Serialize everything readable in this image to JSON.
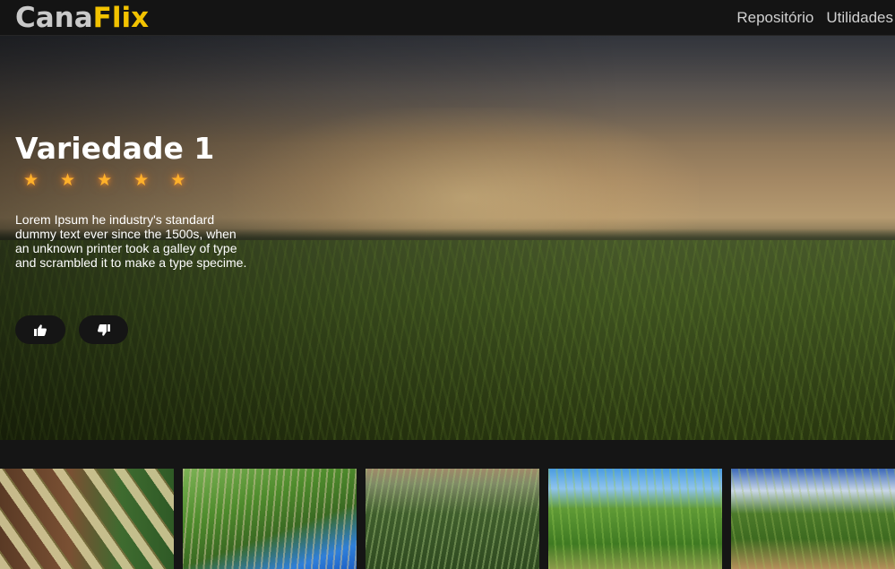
{
  "navbar": {
    "logo_part1": "Cana",
    "logo_part2": "Flix",
    "links": [
      "Repositório",
      "Utilidades"
    ]
  },
  "hero": {
    "title": "Variedade 1",
    "rating": 5,
    "stars": [
      "★",
      "★",
      "★",
      "★",
      "★"
    ],
    "description": "Lorem Ipsum he industry's standard dummy text ever since the 1500s, when an unknown printer took a galley of type and scrambled it to make a type specime.",
    "like_icon": "thumbs-up-icon",
    "dislike_icon": "thumbs-down-icon"
  },
  "gallery": {
    "count": 5
  },
  "colors": {
    "background": "#151515",
    "logo_primary": "#c9c9c9",
    "logo_accent": "#f2c200",
    "star": "#ffb12a",
    "button_bg": "#151515"
  }
}
